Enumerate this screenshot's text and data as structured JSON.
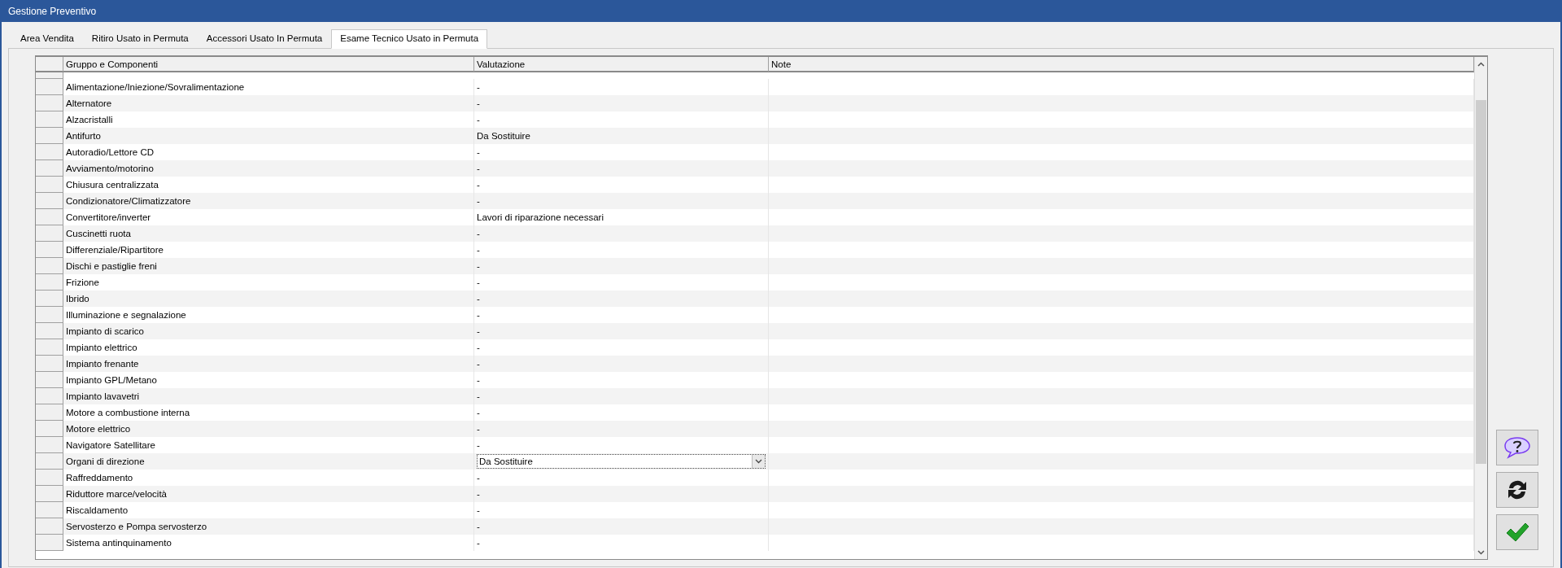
{
  "window": {
    "title": "Gestione Preventivo"
  },
  "tabs": [
    {
      "label": "Area Vendita",
      "selected": false
    },
    {
      "label": "Ritiro Usato in Permuta",
      "selected": false
    },
    {
      "label": "Accessori Usato In  Permuta",
      "selected": false
    },
    {
      "label": "Esame Tecnico Usato in Permuta",
      "selected": true
    }
  ],
  "table": {
    "columns": [
      "Gruppo e Componenti",
      "Valutazione",
      "Note"
    ],
    "rows": [
      {
        "group": "Alimentazione/Iniezione/Sovralimentazione",
        "rating": "-",
        "editing": false
      },
      {
        "group": "Alternatore",
        "rating": "-",
        "editing": false
      },
      {
        "group": "Alzacristalli",
        "rating": "-",
        "editing": false
      },
      {
        "group": "Antifurto",
        "rating": "Da Sostituire",
        "editing": false
      },
      {
        "group": "Autoradio/Lettore CD",
        "rating": "-",
        "editing": false
      },
      {
        "group": "Avviamento/motorino",
        "rating": "-",
        "editing": false
      },
      {
        "group": "Chiusura centralizzata",
        "rating": "-",
        "editing": false
      },
      {
        "group": "Condizionatore/Climatizzatore",
        "rating": "-",
        "editing": false
      },
      {
        "group": "Convertitore/inverter",
        "rating": "Lavori di riparazione necessari",
        "editing": false
      },
      {
        "group": "Cuscinetti ruota",
        "rating": "-",
        "editing": false
      },
      {
        "group": "Differenziale/Ripartitore",
        "rating": "-",
        "editing": false
      },
      {
        "group": "Dischi e pastiglie freni",
        "rating": "-",
        "editing": false
      },
      {
        "group": "Frizione",
        "rating": "-",
        "editing": false
      },
      {
        "group": "Ibrido",
        "rating": "-",
        "editing": false
      },
      {
        "group": "Illuminazione e segnalazione",
        "rating": "-",
        "editing": false
      },
      {
        "group": "Impianto di scarico",
        "rating": "-",
        "editing": false
      },
      {
        "group": "Impianto elettrico",
        "rating": "-",
        "editing": false
      },
      {
        "group": "Impianto frenante",
        "rating": "-",
        "editing": false
      },
      {
        "group": "Impianto GPL/Metano",
        "rating": "-",
        "editing": false
      },
      {
        "group": "Impianto lavavetri",
        "rating": "-",
        "editing": false
      },
      {
        "group": "Motore a combustione interna",
        "rating": "-",
        "editing": false
      },
      {
        "group": "Motore elettrico",
        "rating": "-",
        "editing": false
      },
      {
        "group": "Navigatore Satellitare",
        "rating": "-",
        "editing": false
      },
      {
        "group": "Organi di direzione",
        "rating": "Da Sostituire",
        "editing": true
      },
      {
        "group": "Raffreddamento",
        "rating": "-",
        "editing": false
      },
      {
        "group": "Riduttore marce/velocità",
        "rating": "-",
        "editing": false
      },
      {
        "group": "Riscaldamento",
        "rating": "-",
        "editing": false
      },
      {
        "group": "Servosterzo e Pompa servosterzo",
        "rating": "-",
        "editing": false
      },
      {
        "group": "Sistema antinquinamento",
        "rating": "-",
        "editing": false
      }
    ]
  }
}
